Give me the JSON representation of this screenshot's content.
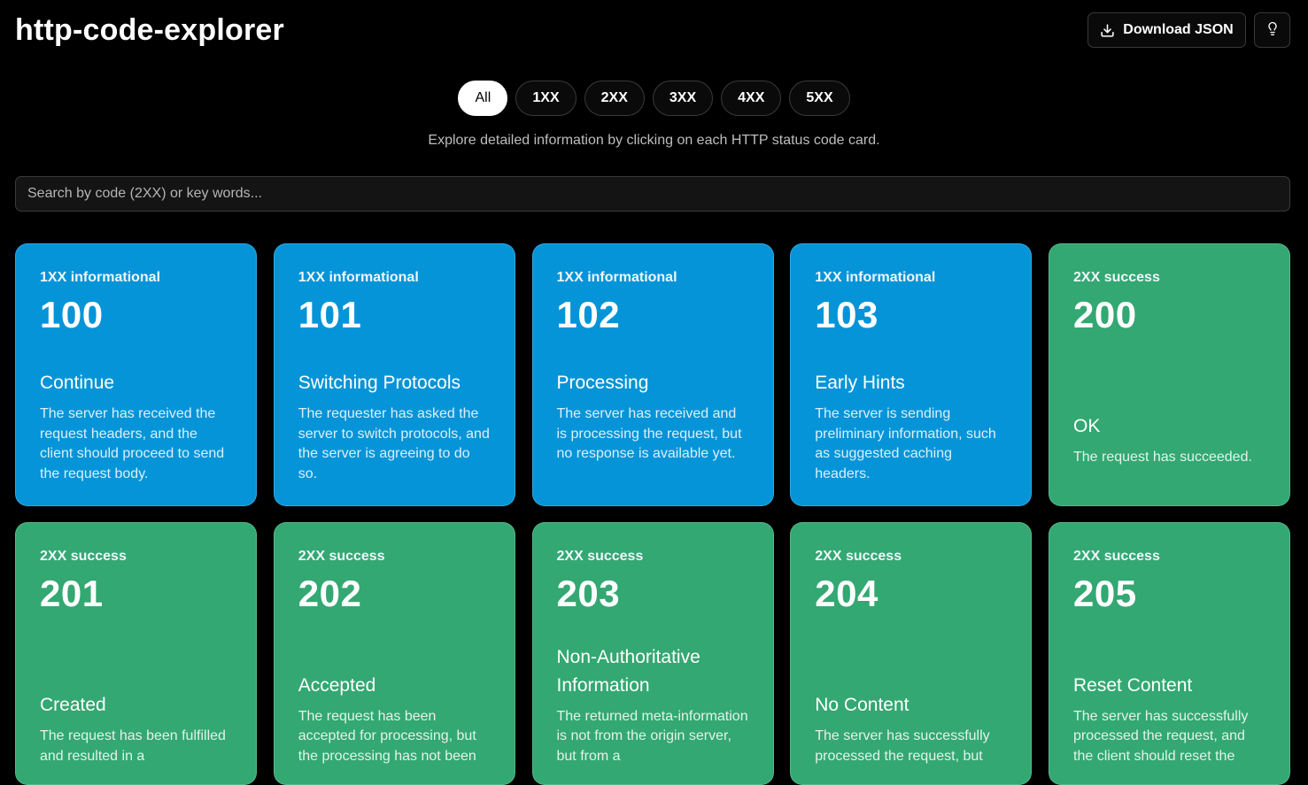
{
  "header": {
    "title": "http-code-explorer",
    "download_label": "Download JSON"
  },
  "icons": {
    "download": "download-icon",
    "hint": "lightbulb-icon"
  },
  "filters": [
    {
      "label": "All",
      "active": true
    },
    {
      "label": "1XX",
      "active": false
    },
    {
      "label": "2XX",
      "active": false
    },
    {
      "label": "3XX",
      "active": false
    },
    {
      "label": "4XX",
      "active": false
    },
    {
      "label": "5XX",
      "active": false
    }
  ],
  "subtitle": "Explore detailed information by clicking on each HTTP status code card.",
  "search": {
    "placeholder": "Search by code (2XX) or key words...",
    "value": ""
  },
  "colors": {
    "informational": "#0594d8",
    "success": "#33a872",
    "background": "#000000"
  },
  "cards": [
    {
      "category": "1XX informational",
      "code": "100",
      "name": "Continue",
      "description": "The server has received the request headers, and the client should proceed to send the request body."
    },
    {
      "category": "1XX informational",
      "code": "101",
      "name": "Switching Protocols",
      "description": "The requester has asked the server to switch protocols, and the server is agreeing to do so."
    },
    {
      "category": "1XX informational",
      "code": "102",
      "name": "Processing",
      "description": "The server has received and is processing the request, but no response is available yet."
    },
    {
      "category": "1XX informational",
      "code": "103",
      "name": "Early Hints",
      "description": "The server is sending preliminary information, such as suggested caching headers."
    },
    {
      "category": "2XX success",
      "code": "200",
      "name": "OK",
      "description": "The request has succeeded."
    },
    {
      "category": "2XX success",
      "code": "201",
      "name": "Created",
      "description": "The request has been fulfilled and resulted in a"
    },
    {
      "category": "2XX success",
      "code": "202",
      "name": "Accepted",
      "description": "The request has been accepted for processing, but the processing has not been"
    },
    {
      "category": "2XX success",
      "code": "203",
      "name": "Non-Authoritative Information",
      "description": "The returned meta-information is not from the origin server, but from a"
    },
    {
      "category": "2XX success",
      "code": "204",
      "name": "No Content",
      "description": "The server has successfully processed the request, but"
    },
    {
      "category": "2XX success",
      "code": "205",
      "name": "Reset Content",
      "description": "The server has successfully processed the request, and the client should reset the"
    }
  ]
}
